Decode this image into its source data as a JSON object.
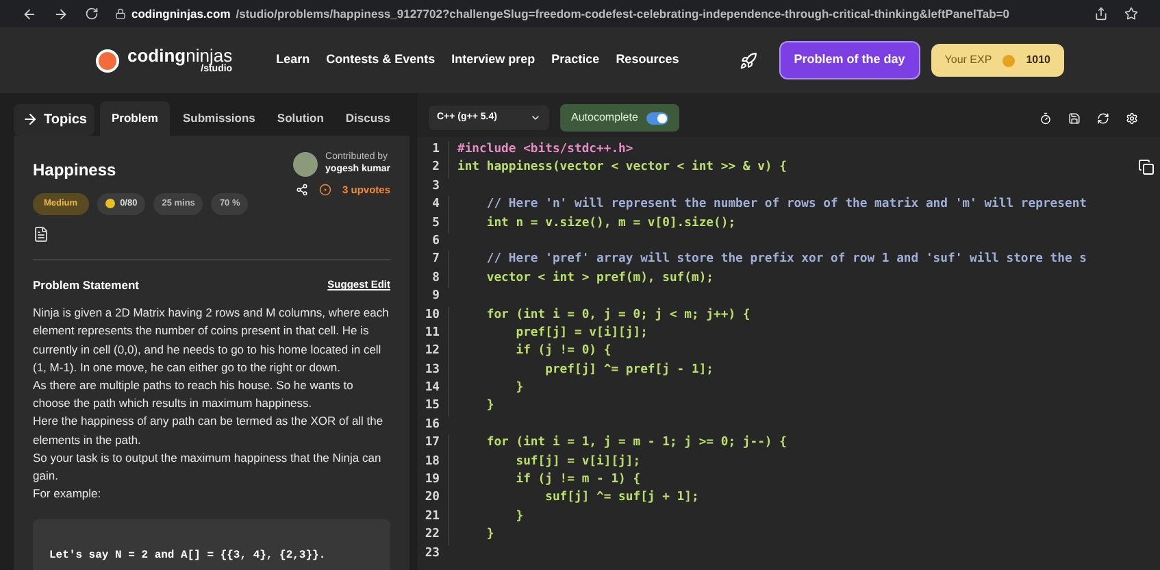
{
  "browser": {
    "url_host": "codingninjas.com",
    "url_path": "/studio/problems/happiness_9127702?challengeSlug=freedom-codefest-celebrating-independence-through-critical-thinking&leftPanelTab=0"
  },
  "nav": {
    "logo": "**coding**ninjas",
    "logo_sub": "/studio",
    "items": [
      "Learn",
      "Contests & Events",
      "Interview prep",
      "Practice",
      "Resources"
    ],
    "problem_of_day": "Problem of the day",
    "exp_label": "Your EXP",
    "exp_value": "1010"
  },
  "left_tabs": {
    "topics": "Topics",
    "tabs": [
      {
        "label": "Problem",
        "selected": true
      },
      {
        "label": "Submissions",
        "selected": false
      },
      {
        "label": "Solution",
        "selected": false
      },
      {
        "label": "Discuss",
        "selected": false
      }
    ]
  },
  "problem": {
    "title": "Happiness",
    "badges": [
      {
        "kind": "difficulty",
        "text": "Medium"
      },
      {
        "kind": "coins",
        "text": "0/80"
      },
      {
        "kind": "plain",
        "text": "25 mins"
      },
      {
        "kind": "plain",
        "text": "70 %"
      }
    ],
    "contributed_label": "Contributed by",
    "contributor": "yogesh kumar",
    "upvotes": "3 upvotes",
    "statement_title": "Problem Statement",
    "suggest_edit": "Suggest Edit",
    "paragraphs": [
      "Ninja is given a 2D Matrix having 2 rows and M columns, where each element represents the number of coins present in that cell. He is currently in cell (0,0), and he needs to go to his home located in cell (1, M-1). In one move, he can either go to the right or down.",
      "As there are multiple paths to reach his house. So he wants to choose the path which results in maximum happiness.",
      "Here the happiness of any path can be termed as the XOR of all the elements in the path.",
      "So your task is to output the maximum happiness that the Ninja can gain.",
      "For example:"
    ],
    "example": "Let's say N = 2 and A[] = {{3, 4}, {2,3}}."
  },
  "editor": {
    "language": "C++ (g++ 5.4)",
    "autocomplete": {
      "label": "Autocomplete",
      "on": true
    },
    "lines": [
      {
        "number": "1",
        "kind": "directive",
        "text": "#include <bits/stdc++.h>"
      },
      {
        "number": "2",
        "kind": "code",
        "text": "int happiness(vector < vector < int >> & v) {"
      },
      {
        "number": "3",
        "kind": "code"
      },
      {
        "number": "4",
        "kind": "comment",
        "text": "    // Here 'n' will represent the number of rows of the matrix and 'm' will represent"
      },
      {
        "number": "5",
        "kind": "code",
        "text": "    int n = v.size(), m = v[0].size();"
      },
      {
        "number": "6",
        "kind": "code"
      },
      {
        "number": "7",
        "kind": "comment",
        "text": "    // Here 'pref' array will store the prefix xor of row 1 and 'suf' will store the s"
      },
      {
        "number": "8",
        "kind": "code",
        "text": "    vector < int > pref(m), suf(m);"
      },
      {
        "number": "9",
        "kind": "code"
      },
      {
        "number": "10",
        "kind": "code",
        "text": "    for (int i = 0, j = 0; j < m; j++) {"
      },
      {
        "number": "11",
        "kind": "code",
        "text": "        pref[j] = v[i][j];"
      },
      {
        "number": "12",
        "kind": "code",
        "text": "        if (j != 0) {"
      },
      {
        "number": "13",
        "kind": "code",
        "text": "            pref[j] ^= pref[j - 1];"
      },
      {
        "number": "14",
        "kind": "code",
        "text": "        }"
      },
      {
        "number": "15",
        "kind": "code",
        "text": "    }"
      },
      {
        "number": "16",
        "kind": "code"
      },
      {
        "number": "17",
        "kind": "code",
        "text": "    for (int i = 1, j = m - 1; j >= 0; j--) {"
      },
      {
        "number": "18",
        "kind": "code",
        "text": "        suf[j] = v[i][j];"
      },
      {
        "number": "19",
        "kind": "code",
        "text": "        if (j != m - 1) {"
      },
      {
        "number": "20",
        "kind": "code",
        "text": "            suf[j] ^= suf[j + 1];"
      },
      {
        "number": "21",
        "kind": "code",
        "text": "        }"
      },
      {
        "number": "22",
        "kind": "code",
        "text": "    }"
      },
      {
        "number": "23",
        "kind": "code"
      }
    ]
  }
}
